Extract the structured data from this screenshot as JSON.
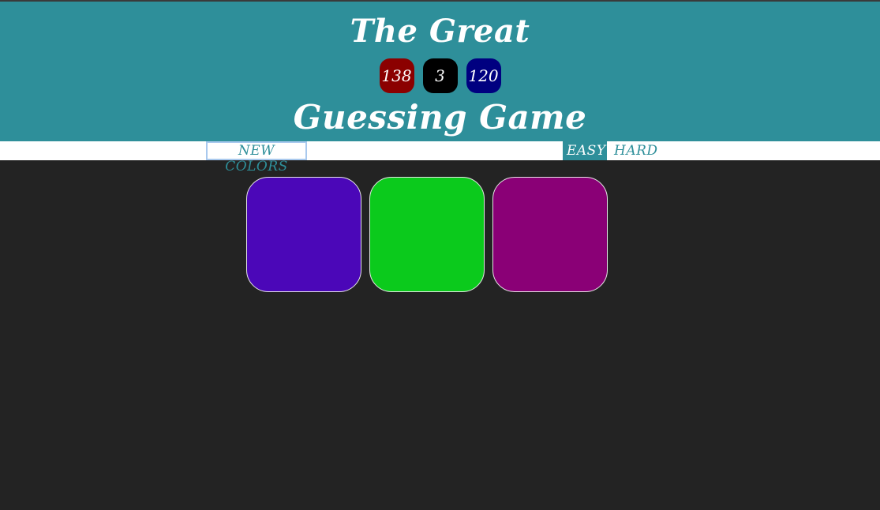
{
  "header": {
    "title_top": "The Great",
    "title_bottom": "Guessing Game",
    "rgb": [
      {
        "value": "138",
        "color": "#8b0000"
      },
      {
        "value": "3",
        "color": "#000000"
      },
      {
        "value": "120",
        "color": "#000080"
      }
    ],
    "bg_color": "#2e8f9a"
  },
  "controls": {
    "new_colors_label": "NEW COLORS",
    "easy_label": "EASY",
    "hard_label": "HARD",
    "selected_mode": "EASY"
  },
  "squares": [
    {
      "color": "#4b07b8"
    },
    {
      "color": "#0bca1c"
    },
    {
      "color": "#8a0076"
    }
  ]
}
